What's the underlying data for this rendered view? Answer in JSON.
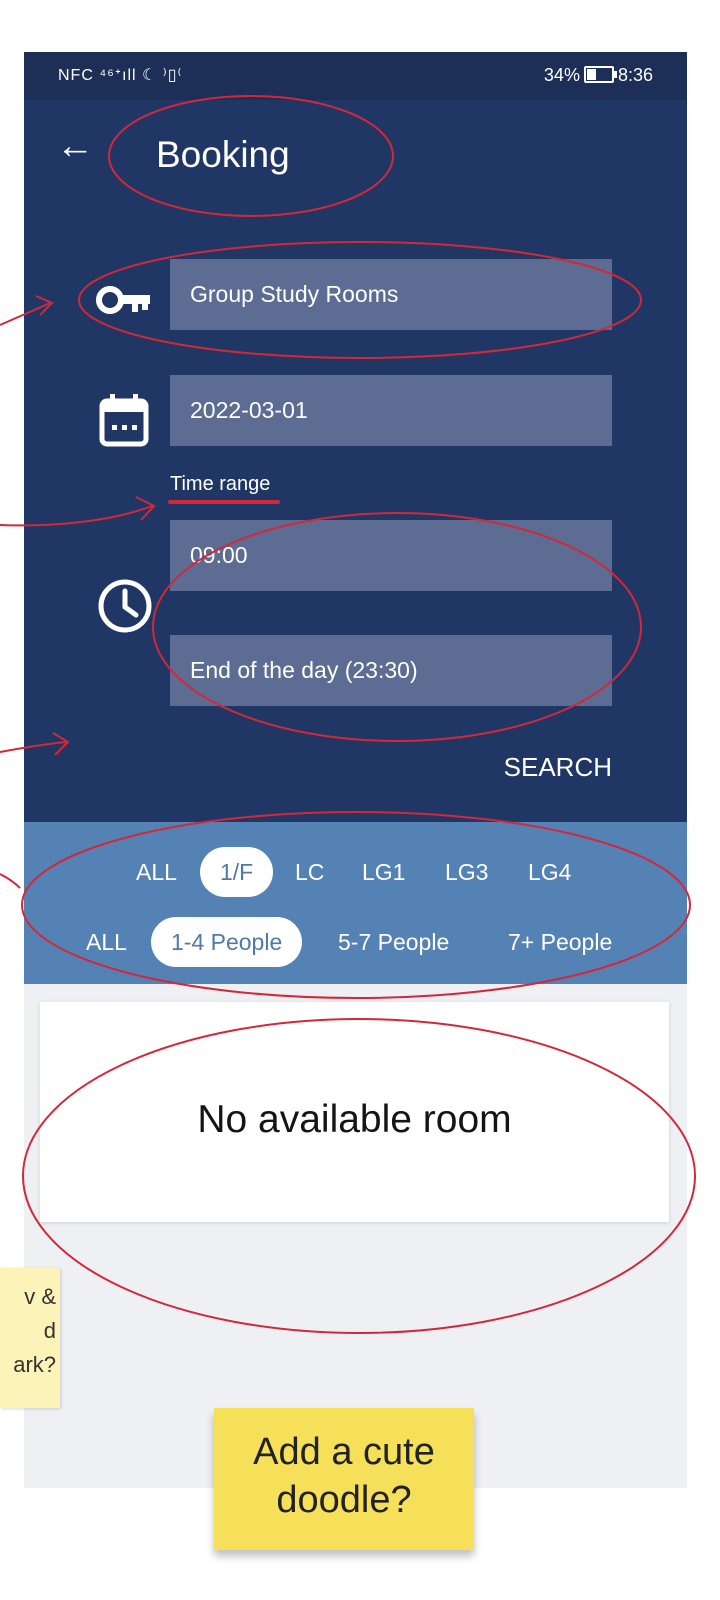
{
  "status": {
    "left_icons": "NFC ⁴⁶ᐩıll ☾ ⁾▯⁽",
    "battery": "34%",
    "time": "8:36"
  },
  "header": {
    "back_icon": "arrow-left-icon",
    "title": "Booking"
  },
  "form": {
    "facility": "Group Study Rooms",
    "date": "2022-03-01",
    "time_range_label": "Time range",
    "start_time": "09:00",
    "end_time": "End of the day (23:30)",
    "search_label": "SEARCH"
  },
  "filters": {
    "floors": [
      "ALL",
      "1/F",
      "LC",
      "LG1",
      "LG3",
      "LG4"
    ],
    "selected_floor": "1/F",
    "sizes": [
      "ALL",
      "1-4 People",
      "5-7 People",
      "7+ People"
    ],
    "selected_size": "1-4 People"
  },
  "results": {
    "empty_message": "No available room"
  },
  "notes": {
    "side_note": [
      "v &",
      "d",
      "ark?"
    ],
    "doodle_note": [
      "Add a cute",
      "doodle?"
    ]
  },
  "colors": {
    "header_bg": "#203765",
    "status_bg": "#1d2f57",
    "field_bg": "#5c6c92",
    "filter_bg": "#5582b4",
    "annotation": "#d3273a",
    "sticky_yellow": "#f6e05a"
  }
}
